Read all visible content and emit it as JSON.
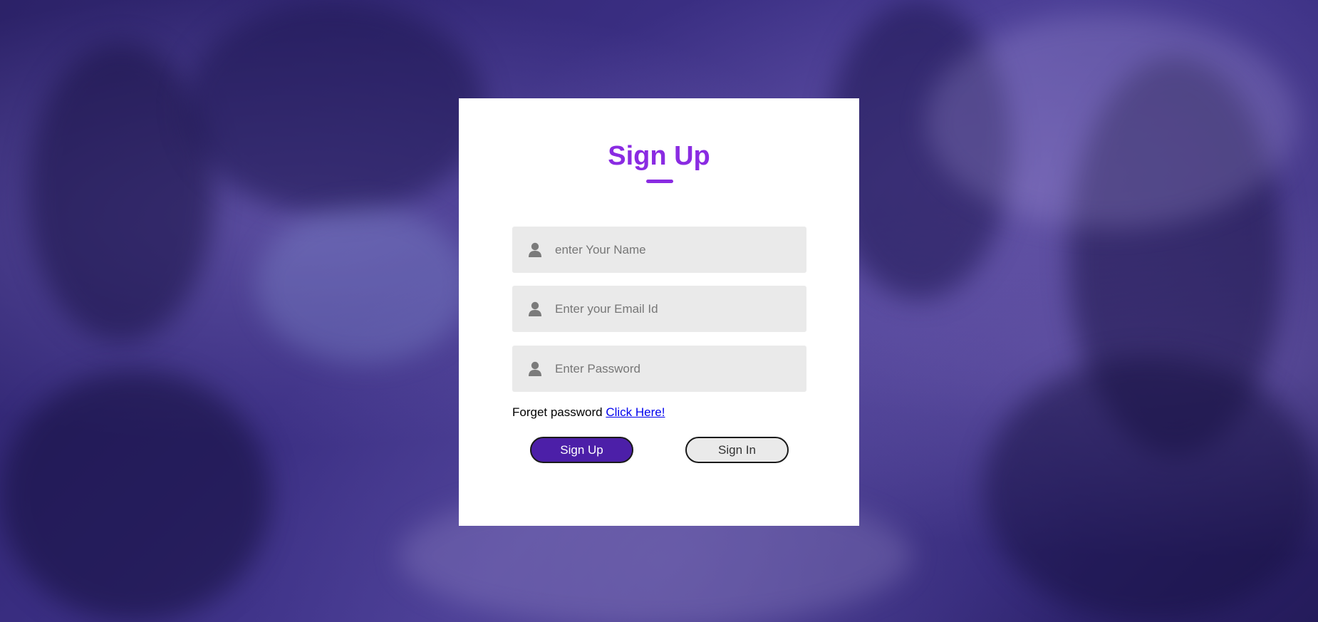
{
  "form": {
    "title": "Sign Up",
    "fields": [
      {
        "name": "name",
        "placeholder": "enter Your Name",
        "icon": "user-icon"
      },
      {
        "name": "email",
        "placeholder": "Enter your Email Id",
        "icon": "user-icon"
      },
      {
        "name": "password",
        "placeholder": "Enter Password",
        "icon": "user-icon"
      }
    ],
    "forgot_text": "Forget password",
    "forgot_link": "Click Here!",
    "signup_label": "Sign Up",
    "signin_label": "Sign In"
  },
  "colors": {
    "accent": "#8a2be2",
    "signup_button": "#4c1fa8",
    "input_bg": "#eaeaea",
    "overlay": "#3a2e82"
  }
}
